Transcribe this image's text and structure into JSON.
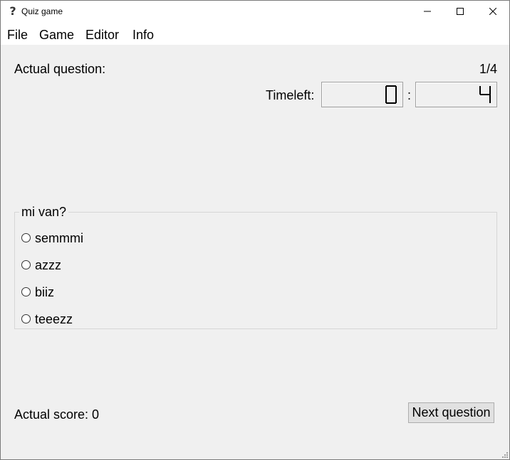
{
  "window": {
    "title": "Quiz game",
    "icon": "question-mark-icon"
  },
  "menu": {
    "items": [
      "File",
      "Game",
      "Editor",
      "Info"
    ]
  },
  "question": {
    "label": "Actual question:",
    "counter": "1/4"
  },
  "timer": {
    "label": "Timeleft:",
    "separator": ":",
    "minutes": "0",
    "seconds": "4"
  },
  "answers": {
    "title": "mi van?",
    "options": [
      "semmmi",
      "azzz",
      "biiz",
      "teeezz"
    ],
    "selected": null
  },
  "score": {
    "label": "Actual score: 0"
  },
  "buttons": {
    "next": "Next question"
  },
  "colors": {
    "window_bg": "#f0f0f0",
    "titlebar_bg": "#ffffff",
    "groupbox_border": "#d6d6d6",
    "button_bg": "#e1e1e1"
  }
}
